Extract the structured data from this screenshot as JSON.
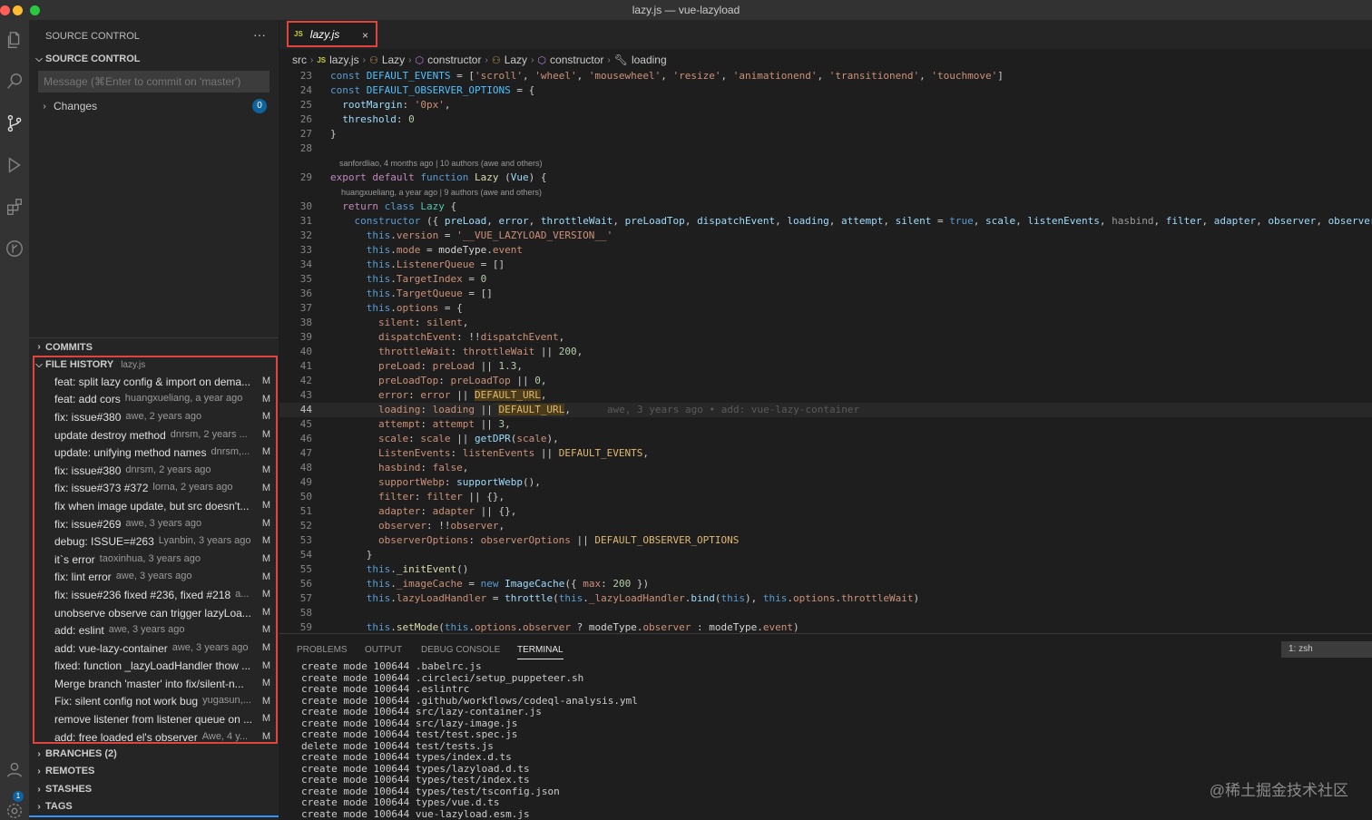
{
  "window": {
    "title": "lazy.js — vue-lazyload",
    "colors": {
      "close": "#ff5f57",
      "minimize": "#febc2e",
      "maximize": "#28c840",
      "accent": "#0e639c",
      "highlight_border": "#e0443f"
    }
  },
  "activity_bar": {
    "icons": [
      "explorer-icon",
      "search-icon",
      "source-control-icon",
      "run-debug-icon",
      "extensions-icon",
      "gitlens-icon",
      "accounts-icon",
      "settings-icon"
    ],
    "accounts_badge": "1"
  },
  "sidebar": {
    "header": "SOURCE CONTROL",
    "more": "···",
    "section_title": "SOURCE CONTROL",
    "commit_placeholder": "Message (⌘Enter to commit on 'master')",
    "changes_label": "Changes",
    "changes_count": "0",
    "commits_title": "COMMITS",
    "file_history": {
      "title": "FILE HISTORY",
      "file": "lazy.js",
      "items": [
        {
          "msg": "feat: split lazy config & import on dema...",
          "meta": "",
          "status": "M"
        },
        {
          "msg": "feat: add cors",
          "meta": "huangxueliang, a year ago",
          "status": "M"
        },
        {
          "msg": "fix: issue#380",
          "meta": "awe, 2 years ago",
          "status": "M"
        },
        {
          "msg": "update destroy method",
          "meta": "dnrsm, 2 years ...",
          "status": "M"
        },
        {
          "msg": "update: unifying method names",
          "meta": "dnrsm,...",
          "status": "M"
        },
        {
          "msg": "fix: issue#380",
          "meta": "dnrsm, 2 years ago",
          "status": "M"
        },
        {
          "msg": "fix: issue#373 #372",
          "meta": "lorna, 2 years ago",
          "status": "M"
        },
        {
          "msg": "fix when image update, but src doesn't...",
          "meta": "",
          "status": "M"
        },
        {
          "msg": "fix: issue#269",
          "meta": "awe, 3 years ago",
          "status": "M"
        },
        {
          "msg": "debug: ISSUE=#263",
          "meta": "Lyanbin, 3 years ago",
          "status": "M"
        },
        {
          "msg": "it`s error",
          "meta": "taoxinhua, 3 years ago",
          "status": "M"
        },
        {
          "msg": "fix: lint error",
          "meta": "awe, 3 years ago",
          "status": "M"
        },
        {
          "msg": "fix: issue#236 fixed #236, fixed #218",
          "meta": "a...",
          "status": "M"
        },
        {
          "msg": "unobserve observe can trigger lazyLoa...",
          "meta": "",
          "status": "M"
        },
        {
          "msg": "add: eslint",
          "meta": "awe, 3 years ago",
          "status": "M"
        },
        {
          "msg": "add: vue-lazy-container",
          "meta": "awe, 3 years ago",
          "status": "M"
        },
        {
          "msg": "fixed: function _lazyLoadHandler thow ...",
          "meta": "",
          "status": "M"
        },
        {
          "msg": "Merge branch 'master' into fix/silent-n...",
          "meta": "",
          "status": "M"
        },
        {
          "msg": "Fix: silent config not work bug",
          "meta": "yugasun,...",
          "status": "M"
        },
        {
          "msg": "remove listener from listener queue on ...",
          "meta": "",
          "status": "M"
        },
        {
          "msg": "add: free loaded el's observer",
          "meta": "Awe, 4 y...",
          "status": "M"
        }
      ]
    },
    "branches_title": "BRANCHES (2)",
    "remotes_title": "REMOTES",
    "stashes_title": "STASHES",
    "tags_title": "TAGS"
  },
  "editor": {
    "tab": {
      "icon": "JS",
      "label": "lazy.js",
      "close": "×"
    },
    "breadcrumb": [
      "src",
      "lazy.js",
      "Lazy",
      "constructor",
      "Lazy",
      "constructor",
      "loading"
    ],
    "blame_29": "sanfordliao, 4 months ago | 10 authors (awe and others)",
    "blame_30": "huangxueliang, a year ago | 9 authors (awe and others)",
    "inline_blame_44": "awe, 3 years ago • add: vue-lazy-container",
    "line_numbers": [
      "23",
      "24",
      "25",
      "26",
      "27",
      "28",
      "29",
      "30",
      "31",
      "32",
      "33",
      "34",
      "35",
      "36",
      "37",
      "38",
      "39",
      "40",
      "41",
      "42",
      "43",
      "44",
      "45",
      "46",
      "47",
      "48",
      "49",
      "50",
      "51",
      "52",
      "53",
      "54",
      "55",
      "56",
      "57",
      "58",
      "59"
    ]
  },
  "panel": {
    "tabs": [
      "PROBLEMS",
      "OUTPUT",
      "DEBUG CONSOLE",
      "TERMINAL"
    ],
    "active_tab": "TERMINAL",
    "terminal_select": "1: zsh",
    "terminal_lines": [
      "create mode 100644 .babelrc.js",
      "create mode 100644 .circleci/setup_puppeteer.sh",
      "create mode 100644 .eslintrc",
      "create mode 100644 .github/workflows/codeql-analysis.yml",
      "create mode 100644 src/lazy-container.js",
      "create mode 100644 src/lazy-image.js",
      "create mode 100644 test/test.spec.js",
      "delete mode 100644 test/tests.js",
      "create mode 100644 types/index.d.ts",
      "create mode 100644 types/lazyload.d.ts",
      "create mode 100644 types/test/index.ts",
      "create mode 100644 types/test/tsconfig.json",
      "create mode 100644 types/vue.d.ts",
      "create mode 100644 vue-lazyload.esm.js"
    ],
    "watermark": "@稀土掘金技术社区"
  }
}
